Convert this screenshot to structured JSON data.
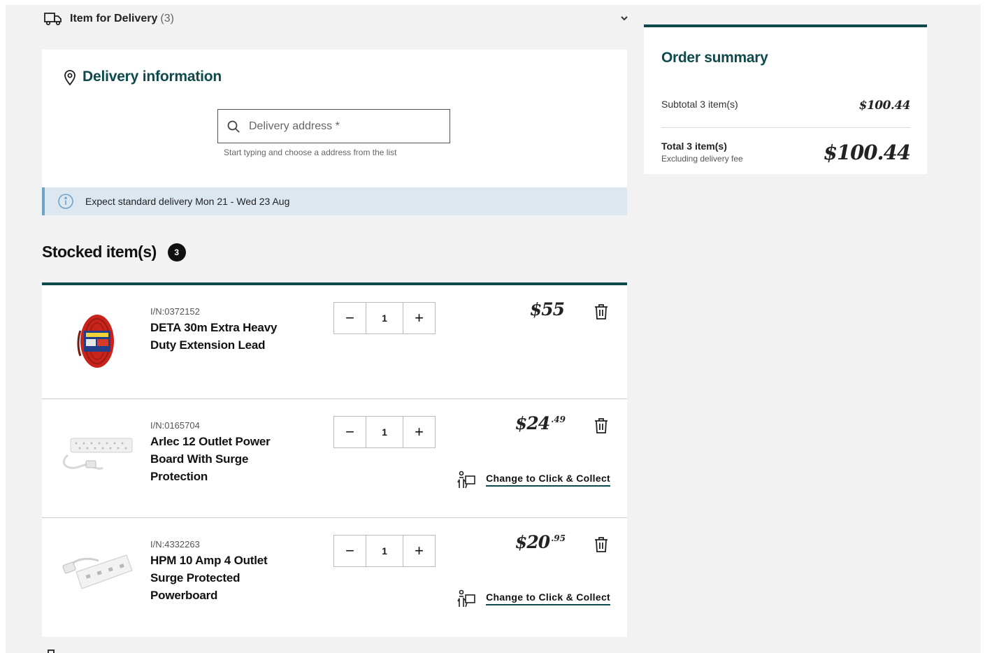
{
  "delivery_section": {
    "title": "Item for Delivery",
    "count": "(3)"
  },
  "delivery_info": {
    "title": "Delivery information",
    "address_placeholder": "Delivery address *",
    "address_value": "",
    "helper_text": "Start typing and choose a address from the list",
    "banner_text": "Expect standard delivery Mon 21 - Wed 23 Aug"
  },
  "stocked": {
    "heading": "Stocked item(s)",
    "badge": "3"
  },
  "items": [
    {
      "sku": "I/N:0372152",
      "name": "DETA 30m Extra Heavy Duty Extension Lead",
      "qty": "1",
      "price_main": "$55",
      "price_cents": "",
      "click_collect": ""
    },
    {
      "sku": "I/N:0165704",
      "name": "Arlec 12 Outlet Power Board With Surge Protection",
      "qty": "1",
      "price_main": "$24",
      "price_cents": ".49",
      "click_collect": "Change to Click & Collect"
    },
    {
      "sku": "I/N:4332263",
      "name": "HPM 10 Amp 4 Outlet Surge Protected Powerboard",
      "qty": "1",
      "price_main": "$20",
      "price_cents": ".95",
      "click_collect": "Change to Click & Collect"
    }
  ],
  "qty_controls": {
    "minus": "−",
    "plus": "+"
  },
  "summary": {
    "title": "Order summary",
    "subtotal_label": "Subtotal 3 item(s)",
    "subtotal_value": "$100.44",
    "total_label": "Total 3 item(s)",
    "total_note": "Excluding delivery fee",
    "total_value": "$100.44"
  },
  "colors": {
    "brand_teal": "#0e4a4c",
    "info_banner": "#dce7f0",
    "info_accent": "#6ba5c8"
  }
}
